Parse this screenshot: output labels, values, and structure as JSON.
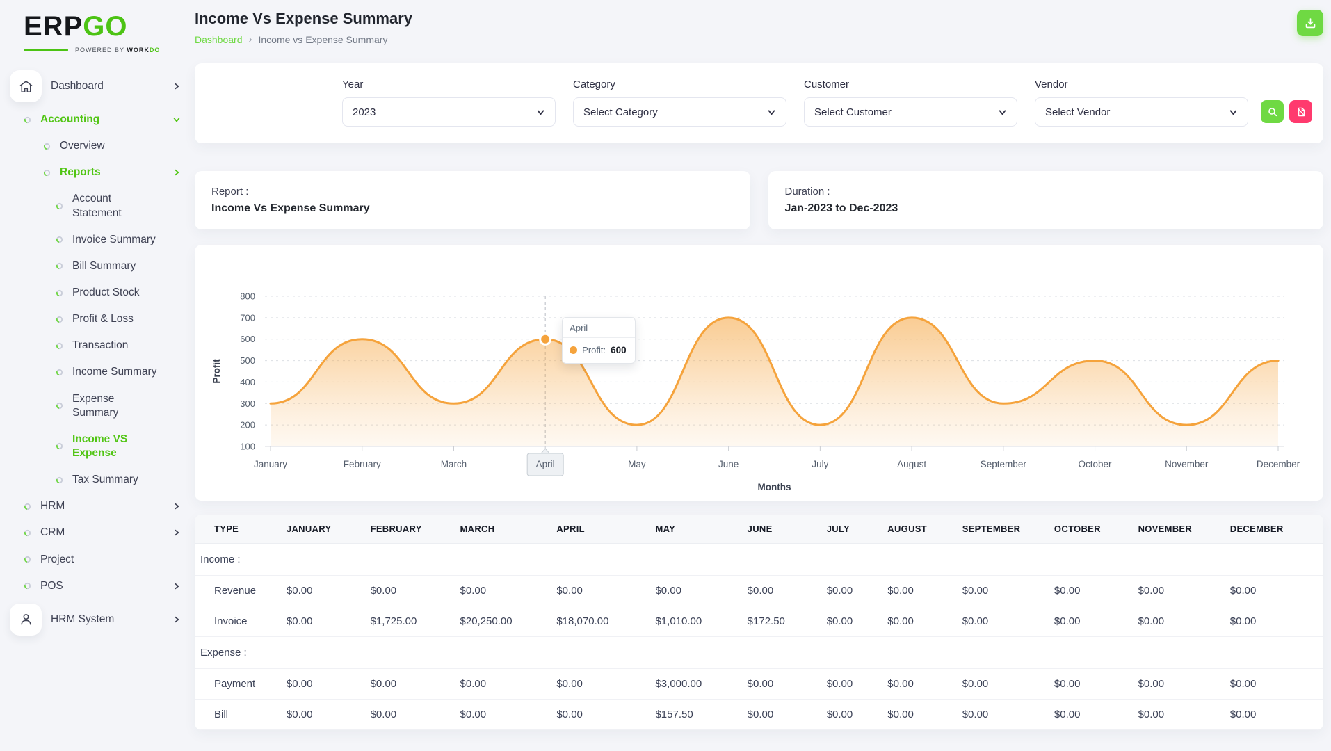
{
  "brand": {
    "name_part1": "ERP",
    "name_part2": "GO",
    "powered_prefix": "Powered By",
    "powered_part1": "WORK",
    "powered_part2": "DO"
  },
  "header": {
    "title": "Income Vs Expense Summary",
    "breadcrumb": {
      "link": "Dashboard",
      "current": "Income vs Expense Summary"
    }
  },
  "sidebar": {
    "items": [
      {
        "label": "Dashboard",
        "icon": "home",
        "tile": true,
        "chevron": "right"
      },
      {
        "label": "Accounting",
        "level": 1,
        "active": true,
        "chevron": "down"
      },
      {
        "label": "Overview",
        "level": 2
      },
      {
        "label": "Reports",
        "level": 2,
        "active": true,
        "chevron": "right"
      },
      {
        "label": "Account Statement",
        "level": 3
      },
      {
        "label": "Invoice Summary",
        "level": 3
      },
      {
        "label": "Bill Summary",
        "level": 3
      },
      {
        "label": "Product Stock",
        "level": 3
      },
      {
        "label": "Profit & Loss",
        "level": 3
      },
      {
        "label": "Transaction",
        "level": 3
      },
      {
        "label": "Income Summary",
        "level": 3
      },
      {
        "label": "Expense Summary",
        "level": 3
      },
      {
        "label": "Income VS Expense",
        "level": 3,
        "active": true
      },
      {
        "label": "Tax Summary",
        "level": 3
      },
      {
        "label": "HRM",
        "level": 1,
        "chevron": "right"
      },
      {
        "label": "CRM",
        "level": 1,
        "chevron": "right"
      },
      {
        "label": "Project",
        "level": 1
      },
      {
        "label": "POS",
        "level": 1,
        "chevron": "right"
      },
      {
        "label": "HRM System",
        "icon": "user",
        "tile": true,
        "chevron": "right"
      }
    ]
  },
  "filters": {
    "year": {
      "label": "Year",
      "value": "2023"
    },
    "category": {
      "label": "Category",
      "value": "Select Category"
    },
    "customer": {
      "label": "Customer",
      "value": "Select Customer"
    },
    "vendor": {
      "label": "Vendor",
      "value": "Select Vendor"
    }
  },
  "icons": {
    "header_action": "download-icon",
    "filter_submit": "search-icon",
    "filter_reset": "clear-file-icon",
    "sidebar_top": "home-icon",
    "sidebar_bottom": "user-icon",
    "menu_bullet": "ring-icon"
  },
  "info_cards": {
    "report": {
      "label": "Report :",
      "value": "Income Vs Expense Summary"
    },
    "duration": {
      "label": "Duration :",
      "value": "Jan-2023 to Dec-2023"
    }
  },
  "chart_data": {
    "type": "area",
    "x": [
      "January",
      "February",
      "March",
      "April",
      "May",
      "June",
      "July",
      "August",
      "September",
      "October",
      "November",
      "December"
    ],
    "series": [
      {
        "name": "Profit",
        "values": [
          300,
          600,
          300,
          600,
          200,
          700,
          200,
          700,
          300,
          500,
          200,
          500
        ]
      }
    ],
    "xlabel": "Months",
    "ylabel": "Profit",
    "ylim": [
      100,
      800
    ],
    "ytick_step": 100,
    "grid": "dashed-horizontal",
    "legend": "none",
    "line_color": "#f5a33c",
    "highlight": {
      "index": 3,
      "month": "April",
      "value": 600
    },
    "tooltip": {
      "title": "April",
      "series_label": "Profit:",
      "value": "600"
    }
  },
  "table": {
    "columns": [
      "TYPE",
      "JANUARY",
      "FEBRUARY",
      "MARCH",
      "APRIL",
      "MAY",
      "JUNE",
      "JULY",
      "AUGUST",
      "SEPTEMBER",
      "OCTOBER",
      "NOVEMBER",
      "DECEMBER"
    ],
    "sections": [
      {
        "title": "Income :",
        "rows": [
          {
            "type": "Revenue",
            "values": [
              "$0.00",
              "$0.00",
              "$0.00",
              "$0.00",
              "$0.00",
              "$0.00",
              "$0.00",
              "$0.00",
              "$0.00",
              "$0.00",
              "$0.00",
              "$0.00"
            ]
          },
          {
            "type": "Invoice",
            "values": [
              "$0.00",
              "$1,725.00",
              "$20,250.00",
              "$18,070.00",
              "$1,010.00",
              "$172.50",
              "$0.00",
              "$0.00",
              "$0.00",
              "$0.00",
              "$0.00",
              "$0.00"
            ]
          }
        ]
      },
      {
        "title": "Expense :",
        "rows": [
          {
            "type": "Payment",
            "values": [
              "$0.00",
              "$0.00",
              "$0.00",
              "$0.00",
              "$3,000.00",
              "$0.00",
              "$0.00",
              "$0.00",
              "$0.00",
              "$0.00",
              "$0.00",
              "$0.00"
            ]
          },
          {
            "type": "Bill",
            "values": [
              "$0.00",
              "$0.00",
              "$0.00",
              "$0.00",
              "$157.50",
              "$0.00",
              "$0.00",
              "$0.00",
              "$0.00",
              "$0.00",
              "$0.00",
              "$0.00"
            ]
          }
        ]
      }
    ]
  },
  "colors": {
    "accent_green": "#51c514",
    "button_green": "#6fd943",
    "logo_green": "#4cc314",
    "pink": "#ff3a6e",
    "chart_orange": "#f5a33c",
    "page_bg": "#f4f5f9"
  }
}
